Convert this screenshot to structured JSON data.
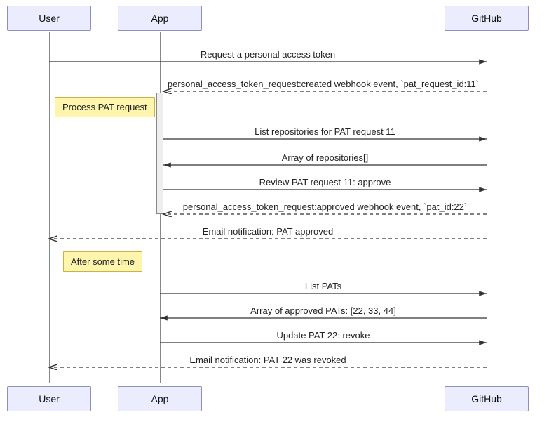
{
  "participants": {
    "user": "User",
    "app": "App",
    "github": "GitHub"
  },
  "messages": {
    "m1": "Request a personal access token",
    "m2": "personal_access_token_request:created webhook event, `pat_request_id:11`",
    "m3": "List repositories for PAT request 11",
    "m4": "Array of repositories[]",
    "m5": "Review PAT request 11: approve",
    "m6": "personal_access_token_request:approved webhook event, `pat_id:22`",
    "m7": "Email notification: PAT approved",
    "m8": "List PATs",
    "m9": "Array of approved PATs: [22, 33, 44]",
    "m10": "Update PAT 22: revoke",
    "m11": "Email notification: PAT 22 was revoked"
  },
  "notes": {
    "n1": "Process PAT request",
    "n2": "After some time"
  },
  "chart_data": {
    "type": "sequence-diagram",
    "participants": [
      "User",
      "App",
      "GitHub"
    ],
    "events": [
      {
        "type": "message",
        "from": "User",
        "to": "GitHub",
        "label": "Request a personal access token",
        "style": "solid"
      },
      {
        "type": "message",
        "from": "GitHub",
        "to": "App",
        "label": "personal_access_token_request:created webhook event, `pat_request_id:11`",
        "style": "dashed"
      },
      {
        "type": "note",
        "over": [
          "User",
          "App"
        ],
        "text": "Process PAT request"
      },
      {
        "type": "activation",
        "participant": "App",
        "start_after": "m2",
        "end_after": "m6"
      },
      {
        "type": "message",
        "from": "App",
        "to": "GitHub",
        "label": "List repositories for PAT request 11",
        "style": "solid"
      },
      {
        "type": "message",
        "from": "GitHub",
        "to": "App",
        "label": "Array of repositories[]",
        "style": "solid"
      },
      {
        "type": "message",
        "from": "App",
        "to": "GitHub",
        "label": "Review PAT request 11: approve",
        "style": "solid"
      },
      {
        "type": "message",
        "from": "GitHub",
        "to": "App",
        "label": "personal_access_token_request:approved webhook event, `pat_id:22`",
        "style": "dashed"
      },
      {
        "type": "message",
        "from": "GitHub",
        "to": "User",
        "label": "Email notification: PAT approved",
        "style": "dashed"
      },
      {
        "type": "note",
        "over": [
          "User",
          "App"
        ],
        "text": "After some time"
      },
      {
        "type": "message",
        "from": "App",
        "to": "GitHub",
        "label": "List PATs",
        "style": "solid"
      },
      {
        "type": "message",
        "from": "GitHub",
        "to": "App",
        "label": "Array of approved PATs: [22, 33, 44]",
        "style": "solid"
      },
      {
        "type": "message",
        "from": "App",
        "to": "GitHub",
        "label": "Update PAT 22: revoke",
        "style": "solid"
      },
      {
        "type": "message",
        "from": "GitHub",
        "to": "User",
        "label": "Email notification: PAT 22 was revoked",
        "style": "dashed"
      }
    ]
  }
}
